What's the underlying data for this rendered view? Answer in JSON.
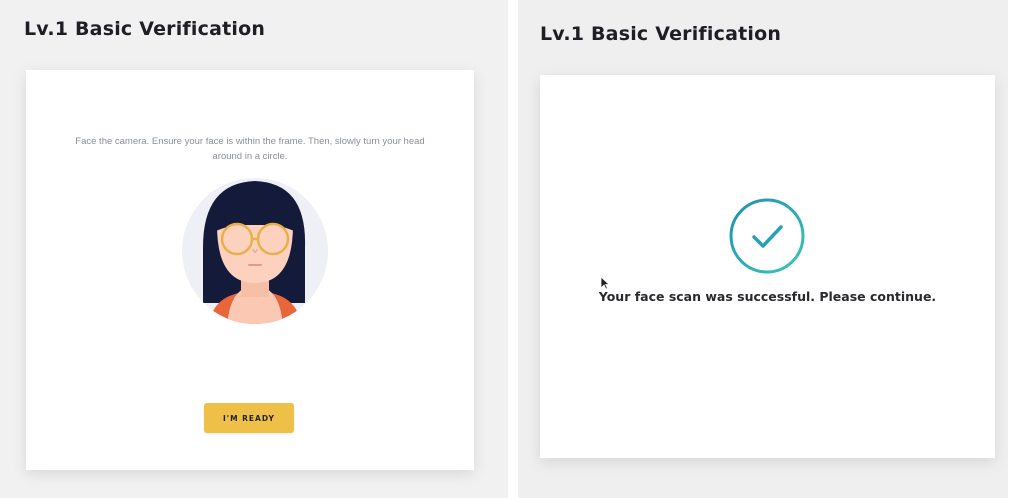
{
  "left_panel": {
    "title": "Lv.1 Basic Verification",
    "instructions": "Face the camera. Ensure your face is within the frame. Then, slowly turn your head around in a circle.",
    "button_label": "I'M READY"
  },
  "right_panel": {
    "title": "Lv.1 Basic Verification",
    "message": "Your face scan was successful. Please continue."
  },
  "icons": {
    "avatar": "face-illustration",
    "success": "checkmark-circle-icon",
    "cursor": "mouse-pointer-icon"
  },
  "colors": {
    "accent_button": "#efc048",
    "success_ring": "#2aa9b0",
    "hair": "#141a3a",
    "skin": "#fcd2bf",
    "glasses": "#e8b04a",
    "shirt": "#e9663a"
  }
}
